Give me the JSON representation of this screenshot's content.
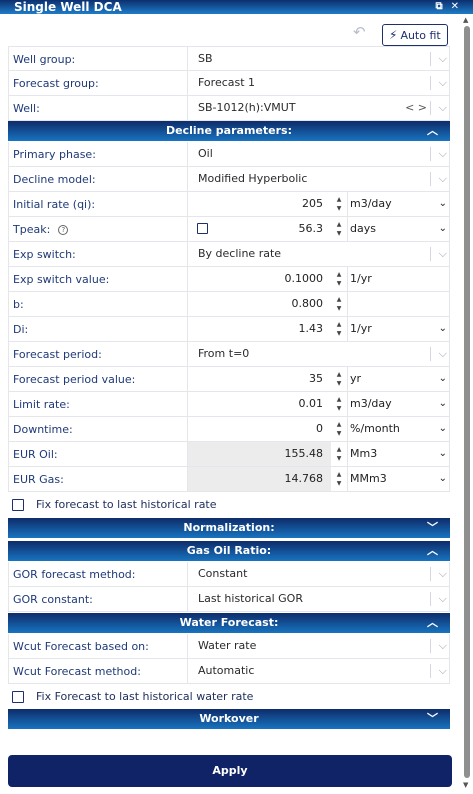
{
  "window": {
    "title": "Single Well DCA"
  },
  "toolbar": {
    "undo_icon": "undo-arrow",
    "autofit_label": "Auto fit",
    "autofit_icon": "lightning-bolt"
  },
  "top_rows": [
    {
      "label": "Well group:",
      "value": "SB"
    },
    {
      "label": "Forecast group:",
      "value": "Forecast 1"
    },
    {
      "label": "Well:",
      "value": "SB-1012(h):VMUT",
      "nav": "< >"
    }
  ],
  "sections": {
    "decline": "Decline parameters:",
    "normalization": "Normalization:",
    "gor": "Gas Oil Ratio:",
    "water": "Water Forecast:",
    "workover": "Workover"
  },
  "decline": {
    "primary_phase": {
      "label": "Primary phase:",
      "value": "Oil"
    },
    "decline_model": {
      "label": "Decline model:",
      "value": "Modified Hyperbolic"
    },
    "initial_rate": {
      "label": "Initial rate (qi):",
      "value": "205",
      "unit": "m3/day"
    },
    "tpeak": {
      "label": "Tpeak:",
      "value": "56.3",
      "unit": "days",
      "checked": false
    },
    "exp_switch": {
      "label": "Exp switch:",
      "value": "By decline rate"
    },
    "exp_switch_value": {
      "label": "Exp switch value:",
      "value": "0.1000",
      "unit": "1/yr"
    },
    "b": {
      "label": "b:",
      "value": "0.800"
    },
    "di": {
      "label": "Di:",
      "value": "1.43",
      "unit": "1/yr"
    },
    "forecast_period": {
      "label": "Forecast period:",
      "value": "From t=0"
    },
    "forecast_period_value": {
      "label": "Forecast period value:",
      "value": "35",
      "unit": "yr"
    },
    "limit_rate": {
      "label": "Limit rate:",
      "value": "0.01",
      "unit": "m3/day"
    },
    "downtime": {
      "label": "Downtime:",
      "value": "0",
      "unit": "%/month"
    },
    "eur_oil": {
      "label": "EUR Oil:",
      "value": "155.48",
      "unit": "Mm3"
    },
    "eur_gas": {
      "label": "EUR Gas:",
      "value": "14.768",
      "unit": "MMm3"
    },
    "fix_label": "Fix forecast to last historical rate"
  },
  "gor": {
    "method": {
      "label": "GOR forecast method:",
      "value": "Constant"
    },
    "constant": {
      "label": "GOR constant:",
      "value": "Last historical GOR"
    }
  },
  "water": {
    "based_on": {
      "label": "Wcut Forecast based on:",
      "value": "Water rate"
    },
    "method": {
      "label": "Wcut Forecast method:",
      "value": "Automatic"
    },
    "fix_label": "Fix Forecast to last historical water rate"
  },
  "apply_label": "Apply",
  "colors": {
    "header": "#0e2c6a",
    "accent": "#1874c0",
    "apply": "#0f2366"
  }
}
